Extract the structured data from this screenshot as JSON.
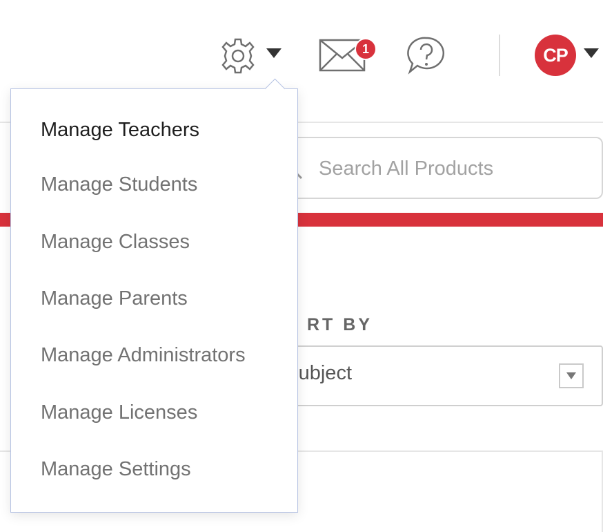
{
  "header": {
    "settings_icon": "gear-icon",
    "settings_caret_icon": "caret-down-icon",
    "mail_icon": "envelope-icon",
    "mail_badge_count": "1",
    "help_icon": "question-icon",
    "avatar_initials": "CP",
    "avatar_color": "#d8323c"
  },
  "search": {
    "placeholder": "Search All Products",
    "value": ""
  },
  "sort": {
    "label_visible": "RT BY",
    "value_visible": "ubject"
  },
  "settings_menu": {
    "items": [
      {
        "label": "Manage Teachers",
        "active": true
      },
      {
        "label": "Manage Students"
      },
      {
        "label": "Manage Classes"
      },
      {
        "label": "Manage Parents"
      },
      {
        "label": "Manage Administrators"
      },
      {
        "label": "Manage Licenses"
      },
      {
        "label": "Manage Settings"
      }
    ]
  },
  "colors": {
    "accent_red": "#d8323c",
    "menu_border": "#b5c2e3"
  }
}
